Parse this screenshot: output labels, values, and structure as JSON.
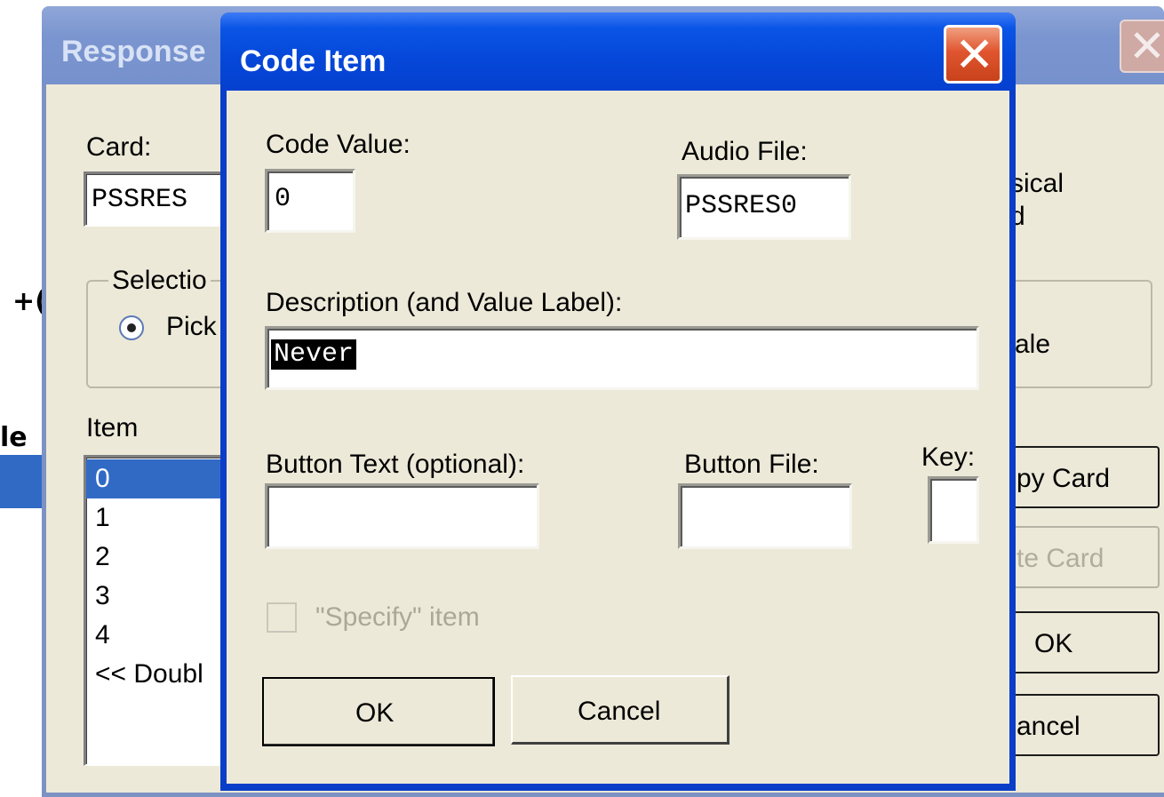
{
  "background_dialog": {
    "title": "Response",
    "card_label": "Card:",
    "card_value": "PSSRES",
    "right_text_1": "sical",
    "right_text_2": "d",
    "selection_group_label": "Selectio",
    "radio_label": "Pick",
    "scale_text": "ale",
    "item_label": "Item",
    "items": [
      "0",
      "1",
      "2",
      "3",
      "4",
      "<< Doubl"
    ],
    "selected_item_index": 0,
    "copy_card_button": "py Card",
    "paste_card_button": "te Card",
    "ok_button": "OK",
    "cancel_button": "ancel"
  },
  "page_fragments": {
    "left_text_1": "+(",
    "left_text_2": "le"
  },
  "code_item_dialog": {
    "title": "Code Item",
    "code_value_label": "Code Value:",
    "code_value": "0",
    "audio_file_label": "Audio File:",
    "audio_file_value": "PSSRES0",
    "description_label": "Description (and Value Label):",
    "description_value": "Never",
    "button_text_label": "Button Text (optional):",
    "button_text_value": "",
    "button_file_label": "Button File:",
    "button_file_value": "",
    "key_label": "Key:",
    "key_value": "",
    "specify_checkbox_label": "\"Specify\" item",
    "specify_checked": false,
    "specify_enabled": false,
    "ok_button": "OK",
    "cancel_button": "Cancel"
  },
  "colors": {
    "titlebar_active": "#0a55e6",
    "titlebar_inactive": "#7a95cf",
    "dialog_face": "#ece9d8",
    "selection": "#316ac5",
    "close_button": "#e0552f"
  },
  "icons": {
    "close": "close-icon"
  }
}
